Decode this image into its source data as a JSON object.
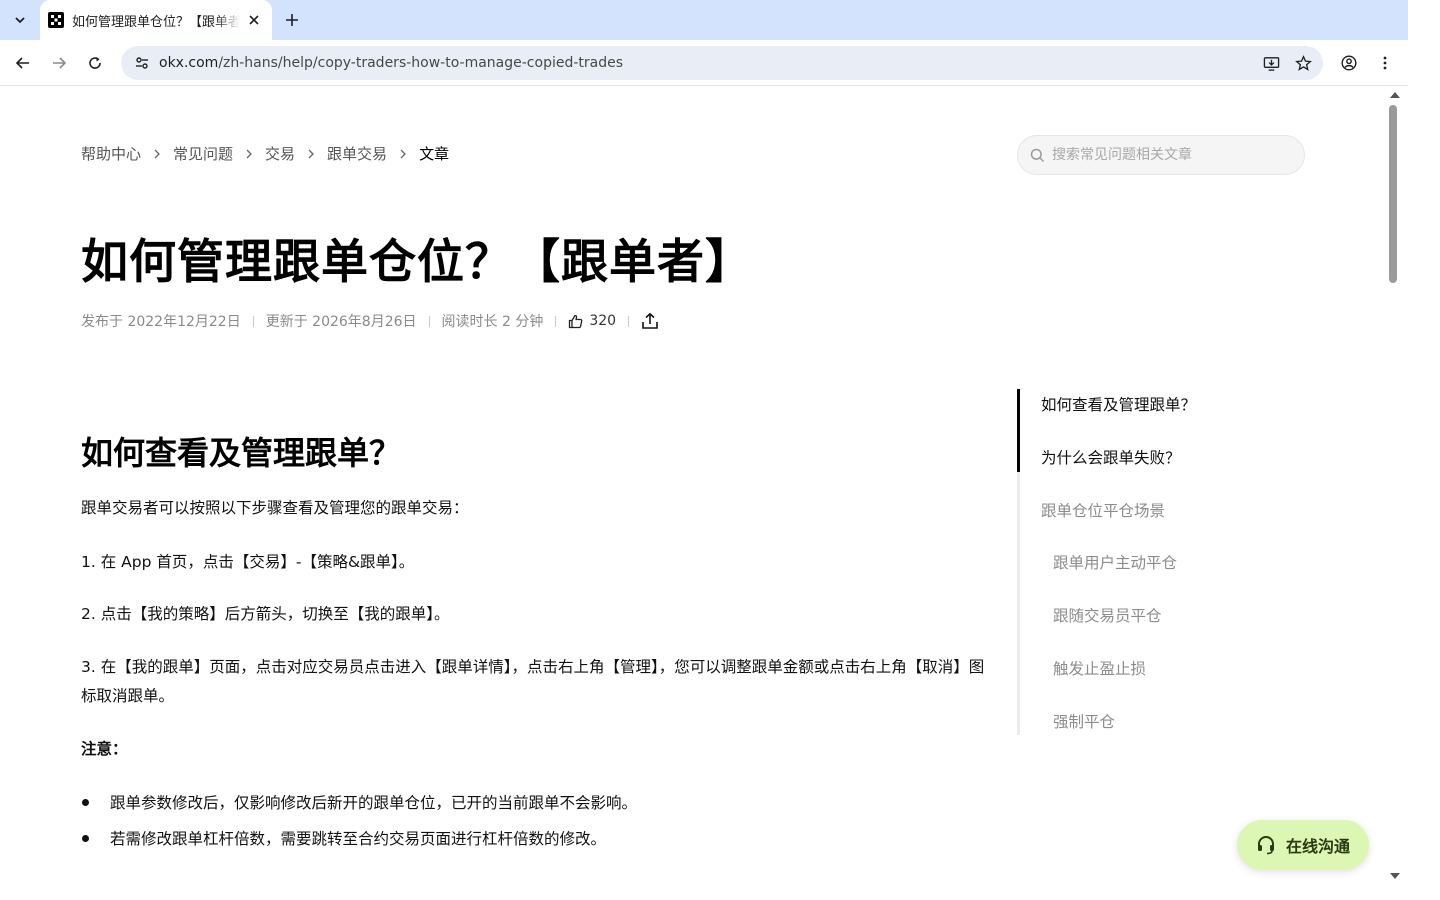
{
  "browser": {
    "tab_title": "如何管理跟单仓位？【跟单者",
    "url_host": "okx.com",
    "url_path": "/zh-hans/help/copy-traders-how-to-manage-copied-trades"
  },
  "breadcrumb": [
    "帮助中心",
    "常见问题",
    "交易",
    "跟单交易",
    "文章"
  ],
  "search": {
    "placeholder": "搜索常见问题相关文章"
  },
  "article": {
    "title": "如何管理跟单仓位？【跟单者】",
    "published": "发布于 2022年12月22日",
    "updated": "更新于 2026年8月26日",
    "read_time": "阅读时长 2 分钟",
    "likes": "320"
  },
  "content": {
    "heading": "如何查看及管理跟单？",
    "intro": "跟单交易者可以按照以下步骤查看及管理您的跟单交易：",
    "step1": "1. 在 App 首页，点击【交易】-【策略&跟单】。",
    "step2": "2. 点击【我的策略】后方箭头，切换至【我的跟单】。",
    "step3": "3. 在【我的跟单】页面，点击对应交易员点击进入【跟单详情】，点击右上角【管理】，您可以调整跟单金额或点击右上角【取消】图标取消跟单。",
    "note_label": "注意：",
    "bullets": [
      "跟单参数修改后，仅影响修改后新开的跟单仓位，已开的当前跟单不会影响。",
      "若需修改跟单杠杆倍数，需要跳转至合约交易页面进行杠杆倍数的修改。"
    ]
  },
  "toc": [
    "如何查看及管理跟单？",
    "为什么会跟单失败？",
    "跟单仓位平仓场景",
    "跟单用户主动平仓",
    "跟随交易员平仓",
    "触发止盈止损",
    "强制平仓"
  ],
  "chat": {
    "label": "在线沟通"
  },
  "colors": {
    "chat_bg": "#dcf6b3",
    "chrome_tab_bar": "#d3e3fd",
    "toc_active": "#000000"
  }
}
